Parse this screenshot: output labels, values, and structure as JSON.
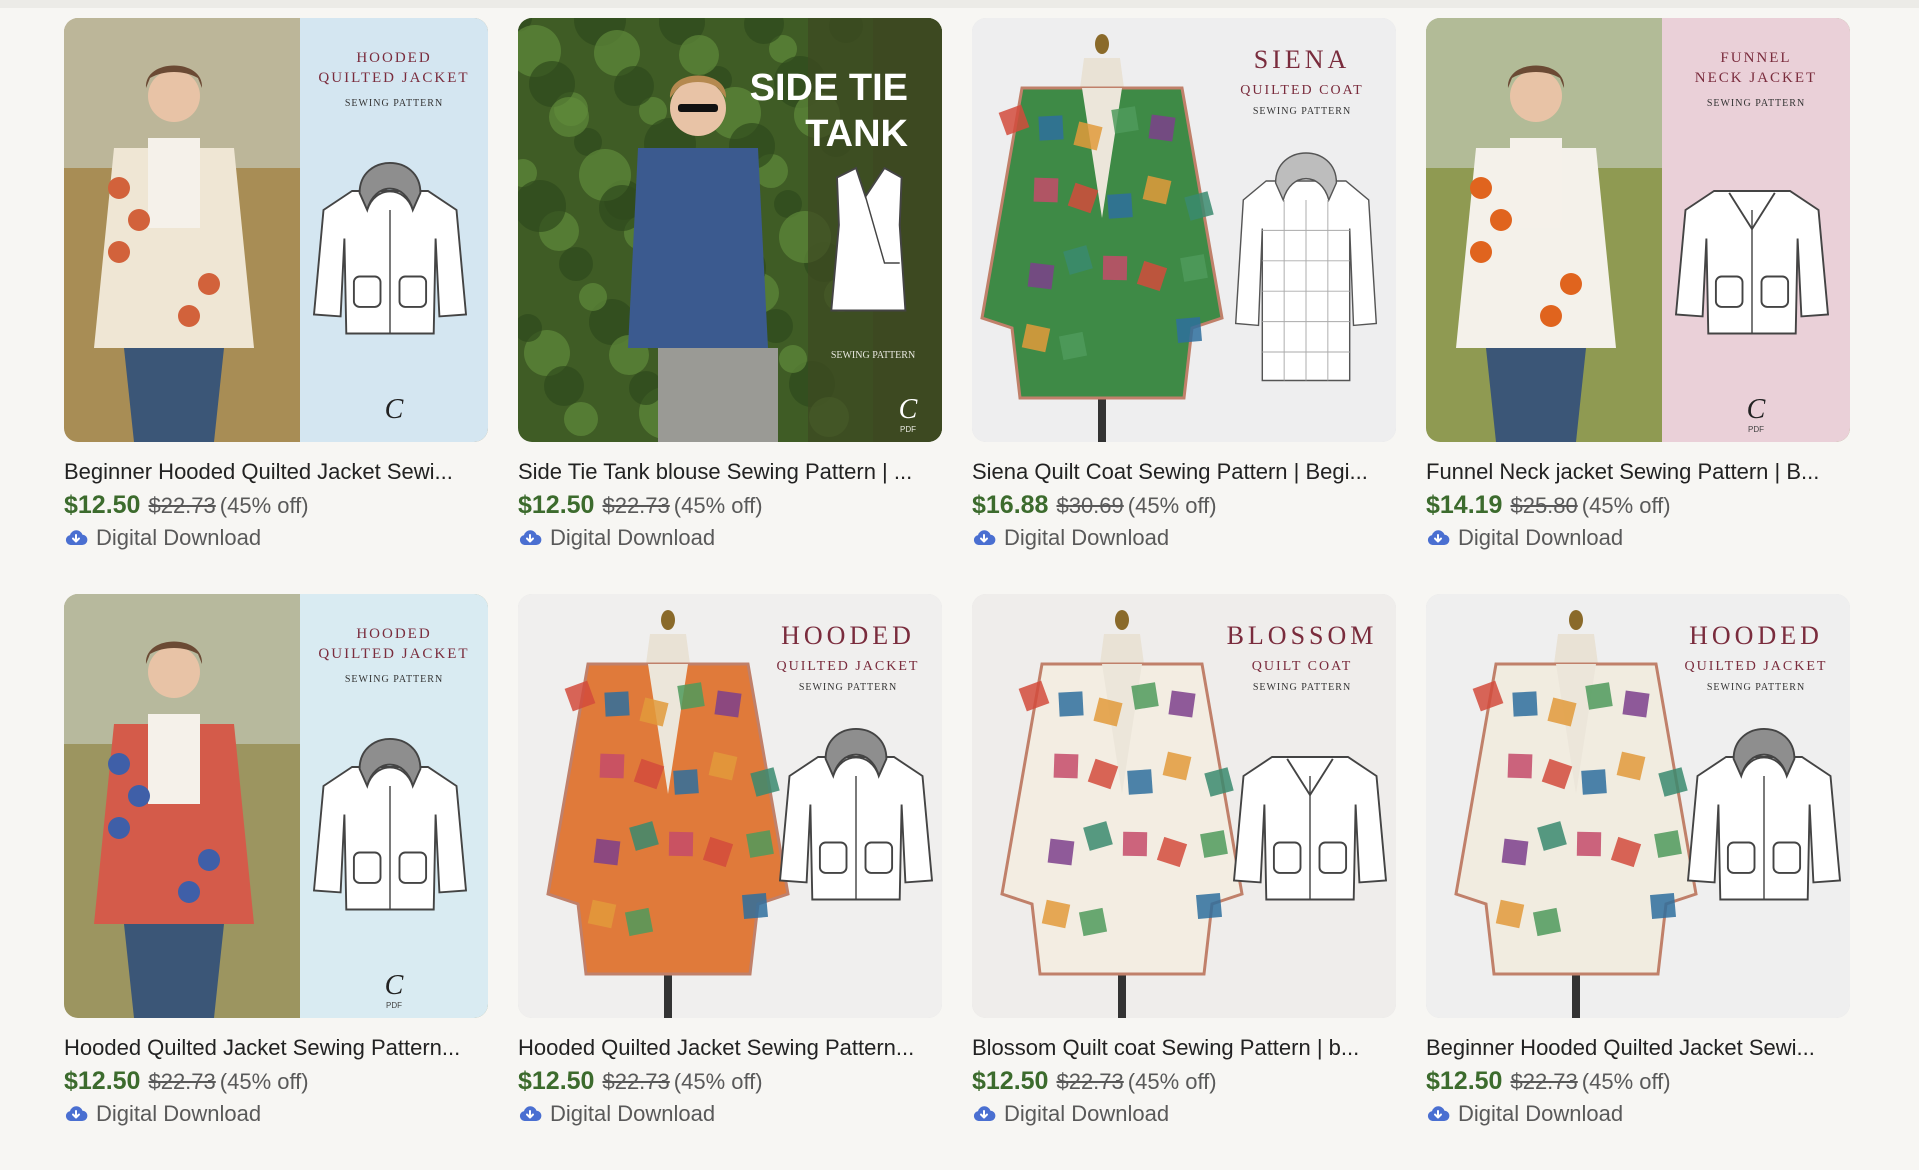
{
  "products": [
    {
      "title": "Beginner Hooded Quilted Jacket Sewi...",
      "price": "$12.50",
      "original_price": "$22.73",
      "discount": "(45% off)",
      "delivery": "Digital Download",
      "image": {
        "style": "photo-panel",
        "panel_color": "#d4e6f1",
        "photo_bg": "#a88d55",
        "garment_color": "#efe6d4",
        "accent_color": "#d2623b",
        "lines": [
          "HOODED",
          "QUILTED JACKET"
        ],
        "sub": "SEWING PATTERN"
      }
    },
    {
      "title": "Side Tie Tank blouse Sewing Pattern | ...",
      "price": "$12.50",
      "original_price": "$22.73",
      "discount": "(45% off)",
      "delivery": "Digital Download",
      "image": {
        "style": "tank",
        "panel_color": "#3e4a22",
        "photo_bg": "#3f5c25",
        "garment_color": "#3b5a8f",
        "accent_color": "#ffffff",
        "lines": [
          "SIDE TIE",
          "TANK"
        ],
        "sub": "SEWING PATTERN",
        "mark": "PDF"
      }
    },
    {
      "title": "Siena Quilt Coat Sewing Pattern | Begi...",
      "price": "$16.88",
      "original_price": "$30.69",
      "discount": "(45% off)",
      "delivery": "Digital Download",
      "image": {
        "style": "mannequin",
        "panel_color": "#eeeeef",
        "photo_bg": "#eeeeef",
        "garment_color": "#3e8a46",
        "accent_color": "#7a2c3d",
        "lines": [
          "SIENA",
          "QUILTED COAT"
        ],
        "sub": "SEWING PATTERN"
      }
    },
    {
      "title": "Funnel Neck jacket Sewing Pattern | B...",
      "price": "$14.19",
      "original_price": "$25.80",
      "discount": "(45% off)",
      "delivery": "Digital Download",
      "image": {
        "style": "photo-panel",
        "panel_color": "#ead0d8",
        "photo_bg": "#8f9a52",
        "garment_color": "#f4f1ea",
        "accent_color": "#e0641e",
        "lines": [
          "FUNNEL",
          "NECK JACKET"
        ],
        "sub": "SEWING PATTERN",
        "mark": "PDF"
      }
    },
    {
      "title": "Hooded Quilted Jacket Sewing Pattern...",
      "price": "$12.50",
      "original_price": "$22.73",
      "discount": "(45% off)",
      "delivery": "Digital Download",
      "image": {
        "style": "photo-panel",
        "panel_color": "#d9ebf2",
        "photo_bg": "#9c9560",
        "garment_color": "#d45b4a",
        "accent_color": "#3f5fa8",
        "lines": [
          "HOODED",
          "QUILTED JACKET"
        ],
        "sub": "SEWING PATTERN",
        "mark": "PDF"
      }
    },
    {
      "title": "Hooded Quilted Jacket Sewing Pattern...",
      "price": "$12.50",
      "original_price": "$22.73",
      "discount": "(45% off)",
      "delivery": "Digital Download",
      "image": {
        "style": "mannequin",
        "panel_color": "#f0efee",
        "photo_bg": "#f0efee",
        "garment_color": "#e07a3a",
        "accent_color": "#7a2c3d",
        "lines": [
          "HOODED",
          "QUILTED JACKET"
        ],
        "sub": "SEWING PATTERN"
      }
    },
    {
      "title": "Blossom Quilt coat Sewing Pattern | b...",
      "price": "$12.50",
      "original_price": "$22.73",
      "discount": "(45% off)",
      "delivery": "Digital Download",
      "image": {
        "style": "mannequin",
        "panel_color": "#efedeb",
        "photo_bg": "#efedeb",
        "garment_color": "#f3ede2",
        "accent_color": "#7a2c3d",
        "lines": [
          "BLOSSOM",
          "QUILT COAT"
        ],
        "sub": "SEWING PATTERN"
      }
    },
    {
      "title": "Beginner Hooded Quilted Jacket Sewi...",
      "price": "$12.50",
      "original_price": "$22.73",
      "discount": "(45% off)",
      "delivery": "Digital Download",
      "image": {
        "style": "mannequin",
        "panel_color": "#efefef",
        "photo_bg": "#efefef",
        "garment_color": "#f1ece0",
        "accent_color": "#7a2c3d",
        "lines": [
          "HOODED",
          "QUILTED JACKET"
        ],
        "sub": "SEWING PATTERN"
      }
    }
  ],
  "colors": {
    "price": "#3c6b2d",
    "muted": "#595959",
    "download_icon": "#4a6fd1",
    "background": "#f7f6f3"
  },
  "icons": {
    "download": "cloud-download-icon"
  }
}
